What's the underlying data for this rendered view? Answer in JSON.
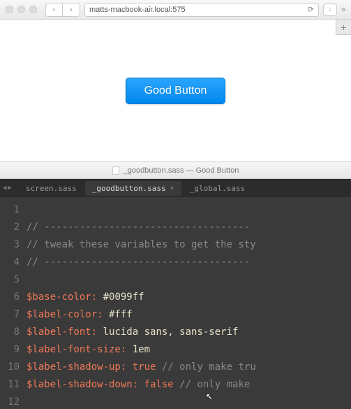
{
  "browser": {
    "url": "matts-macbook-air.local:575",
    "button_label": "Good Button"
  },
  "editor": {
    "titlebar": "_goodbutton.sass — Good Button",
    "tabs": {
      "screen": "screen.sass",
      "goodbutton": "_goodbutton.sass",
      "global": "_global.sass"
    },
    "lines": {
      "l1": "",
      "l2_comment": "// -----------------------------------",
      "l3_comment": "// tweak these variables to get the sty",
      "l4_comment": "// -----------------------------------",
      "l5": "",
      "l6_var": "$base-color:",
      "l6_val": " #0099ff",
      "l7_var": "$label-color:",
      "l7_val": " #fff",
      "l8_var": "$label-font:",
      "l8_val": " lucida sans, sans-serif",
      "l9_var": "$label-font-size:",
      "l9_val": " 1em",
      "l10_var": "$label-shadow-up:",
      "l10_val": " true",
      "l10_comment": " // only make tru",
      "l11_var": "$label-shadow-down:",
      "l11_val": " false",
      "l11_comment": " // only make ",
      "l12": ""
    },
    "gutter": {
      "n1": "1",
      "n2": "2",
      "n3": "3",
      "n4": "4",
      "n5": "5",
      "n6": "6",
      "n7": "7",
      "n8": "8",
      "n9": "9",
      "n10": "10",
      "n11": "11",
      "n12": "12"
    }
  }
}
